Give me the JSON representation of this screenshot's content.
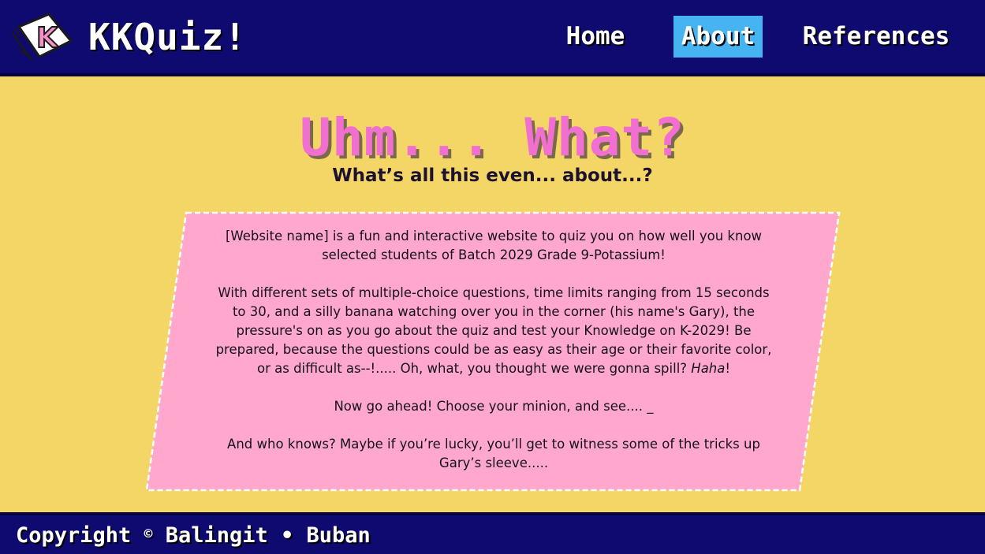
{
  "brand": {
    "logo_letter": "K",
    "title": "KKQuiz!"
  },
  "nav": {
    "items": [
      {
        "label": "Home",
        "active": false
      },
      {
        "label": "About",
        "active": true
      },
      {
        "label": "References",
        "active": false
      }
    ]
  },
  "page": {
    "headline": "Uhm... What?",
    "subheadline": "What’s all this even... about...?"
  },
  "card": {
    "p1": "[Website name] is a fun and interactive website to quiz you on how well you know selected students of Batch 2029 Grade 9-Potassium!",
    "p2_before": "With different sets of multiple-choice questions, time limits ranging from 15 seconds to 30, and a silly banana watching over you in the corner (his name's Gary), the pressure's on as you go about the quiz and test your Knowledge on K-2029! Be prepared, because the questions could be as easy as their age or their favorite color, or as difficult as--!..... Oh, what, you thought we were gonna spill? ",
    "p2_emphasis": "Haha",
    "p2_after": "!",
    "p3": "Now go ahead! Choose your minion, and see.... _",
    "p4": "And who knows? Maybe if you’re lucky, you’ll get to witness some of the tricks up Gary’s sleeve....."
  },
  "footer": {
    "prefix": "Copyright",
    "copyright_symbol": "©",
    "author1": "Balingit",
    "separator": "•",
    "author2": "Buban"
  },
  "colors": {
    "navbar": "#0e0a70",
    "page_background": "#f3d666",
    "card_background": "#ffa7cc",
    "headline": "#f06fd0",
    "nav_active": "#45b4f0"
  },
  "icons": [
    "kkquiz-logo-icon"
  ]
}
